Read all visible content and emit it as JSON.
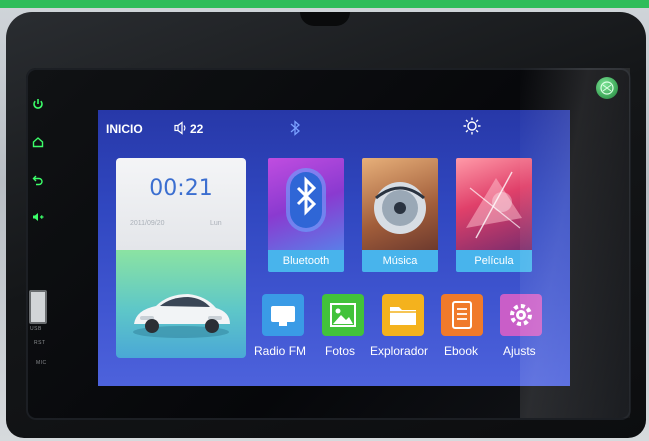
{
  "status_bar": {
    "home_label": "INICIO",
    "volume_icon": "speaker-icon",
    "volume_value": "22",
    "bluetooth_icon": "bluetooth-icon",
    "brightness_icon": "brightness-icon"
  },
  "clock": {
    "time": "00:21",
    "date": "2011/09/20",
    "day": "Lun"
  },
  "media_tiles": [
    {
      "label": "Bluetooth",
      "icon": "bluetooth-icon"
    },
    {
      "label": "Música",
      "icon": "music-disc-icon"
    },
    {
      "label": "Película",
      "icon": "film-icon"
    }
  ],
  "apps": [
    {
      "label": "Radio FM",
      "icon": "radio-icon",
      "color": "#3a9be6"
    },
    {
      "label": "Fotos",
      "icon": "photos-icon",
      "color": "#42c23a"
    },
    {
      "label": "Explorador",
      "icon": "folder-icon",
      "color": "#f4b21d"
    },
    {
      "label": "Ebook",
      "icon": "ebook-icon",
      "color": "#f07a2a"
    },
    {
      "label": "Ajusts",
      "icon": "settings-icon",
      "color": "#c95ec8"
    }
  ],
  "hardware": {
    "side_buttons": [
      "power-icon",
      "home-icon",
      "back-icon",
      "volume-up-icon"
    ],
    "port_labels": [
      "USB",
      "RST",
      "MIC"
    ]
  },
  "colors": {
    "screen_top": "#2738a8",
    "screen_bottom": "#4d62dc",
    "tile_label_bg": "#48b4ec",
    "clock_text": "#3b6ed0",
    "side_button_glow": "#3cff6a"
  }
}
